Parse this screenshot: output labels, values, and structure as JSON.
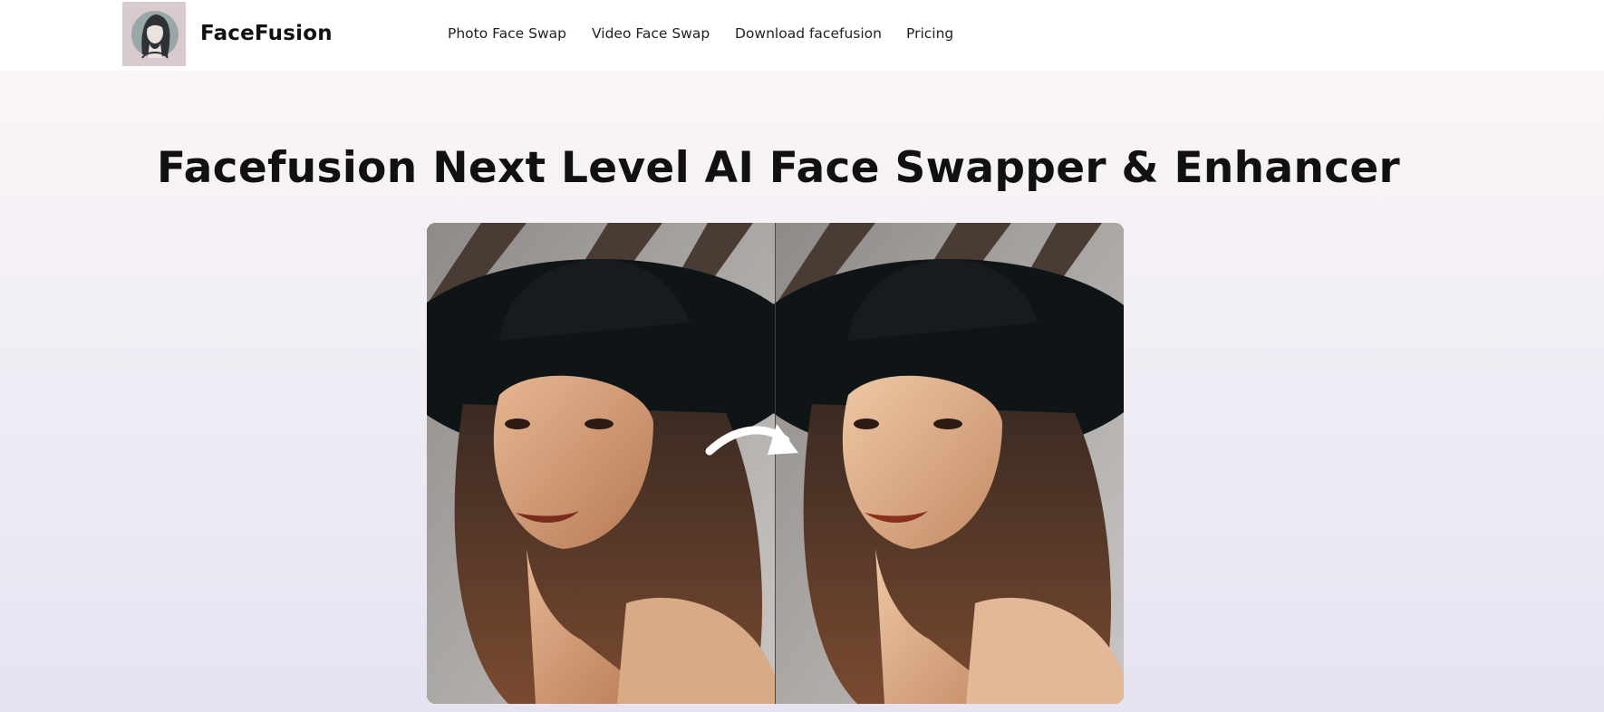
{
  "header": {
    "brand": "FaceFusion",
    "logo_icon": "woman-portrait-logo-icon",
    "nav": [
      {
        "label": "Photo Face Swap"
      },
      {
        "label": "Video Face Swap"
      },
      {
        "label": "Download facefusion"
      },
      {
        "label": "Pricing"
      }
    ]
  },
  "hero": {
    "title": "Facefusion Next Level AI Face Swapper & Enhancer",
    "image": {
      "name": "before-after-face-swap-image",
      "arrow_icon": "curved-arrow-right-icon"
    }
  },
  "colors": {
    "header_bg": "#ffffff",
    "logo_bg": "#d8cacd",
    "title_text": "#111111",
    "nav_text": "#222222",
    "page_gradient_top": "#fdf7f7",
    "page_gradient_bottom": "#e6e3f2"
  }
}
